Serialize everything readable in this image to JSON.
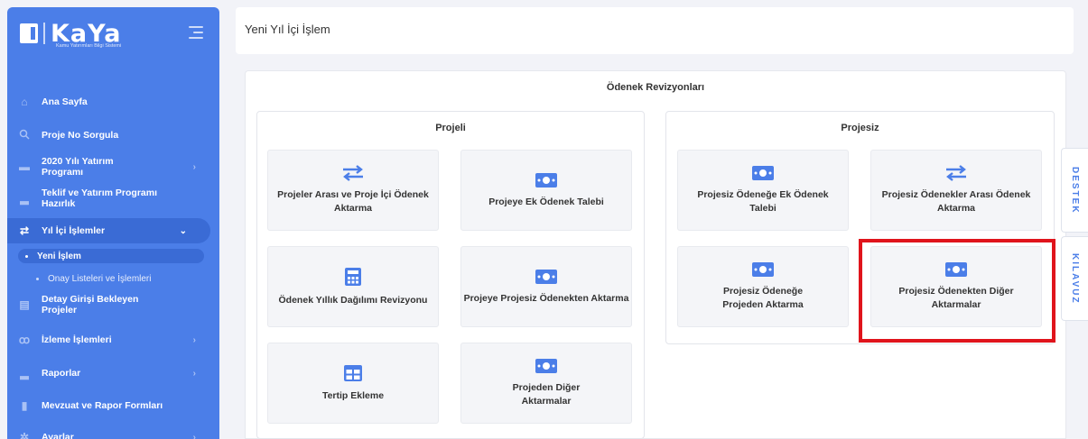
{
  "brand": {
    "name": "KaYa",
    "subtitle": "Kamu Yatırımları Bilgi Sistemi"
  },
  "sidebar": {
    "items": [
      {
        "label": "Ana Sayfa",
        "icon": "home-icon"
      },
      {
        "label": "Proje No Sorgula",
        "icon": "search-icon"
      },
      {
        "label": "2020 Yılı Yatırım Programı",
        "icon": "folder-icon",
        "chevron": "›"
      },
      {
        "label": "Teklif ve Yatırım Programı Hazırlık",
        "icon": "chart-icon"
      },
      {
        "label": "Yıl İçi İşlemler",
        "icon": "transfer-icon",
        "chevron": "⌄"
      },
      {
        "label": "Detay Girişi Bekleyen Projeler",
        "icon": "list-icon"
      },
      {
        "label": "İzleme İşlemleri",
        "icon": "binoculars-icon",
        "chevron": "›"
      },
      {
        "label": "Raporlar",
        "icon": "chart-icon",
        "chevron": "›"
      },
      {
        "label": "Mevzuat ve Rapor Formları",
        "icon": "document-icon"
      },
      {
        "label": "Ayarlar",
        "icon": "gear-icon",
        "chevron": "›"
      }
    ],
    "subitems": [
      {
        "label": "Yeni İşlem"
      },
      {
        "label": "Onay Listeleri ve İşlemleri"
      }
    ]
  },
  "header": {
    "title": "Yeni Yıl İçi İşlem"
  },
  "revisions": {
    "title": "Ödenek Revizyonları",
    "projeli": {
      "title": "Projeli",
      "tiles": [
        {
          "label": "Projeler Arası ve Proje İçi Ödenek Aktarma",
          "icon": "transfer-icon"
        },
        {
          "label": "Projeye Ek Ödenek Talebi",
          "icon": "money-icon"
        },
        {
          "label": "Ödenek Yıllık Dağılımı Revizyonu",
          "icon": "calculator-icon"
        },
        {
          "label": "Projeye Projesiz Ödenekten Aktarma",
          "icon": "money-icon"
        },
        {
          "label": "Tertip Ekleme",
          "icon": "table-icon"
        },
        {
          "label": "Projeden Diğer Aktarmalar",
          "icon": "money-icon"
        }
      ]
    },
    "projesiz": {
      "title": "Projesiz",
      "tiles": [
        {
          "label": "Projesiz Ödeneğe Ek Ödenek Talebi",
          "icon": "money-icon"
        },
        {
          "label": "Projesiz Ödenekler Arası Ödenek Aktarma",
          "icon": "transfer-icon"
        },
        {
          "label": "Projesiz Ödeneğe Projeden Aktarma",
          "icon": "money-icon"
        },
        {
          "label": "Projesiz Ödenekten Diğer Aktarmalar",
          "icon": "money-icon"
        }
      ]
    }
  },
  "side_tabs": {
    "support": "DESTEK",
    "guide": "KILAVUZ"
  },
  "colors": {
    "sidebar": "#4b7ee8",
    "accent": "#3a6bd5",
    "highlight": "#e0141c",
    "tile": "#f4f5f8"
  }
}
